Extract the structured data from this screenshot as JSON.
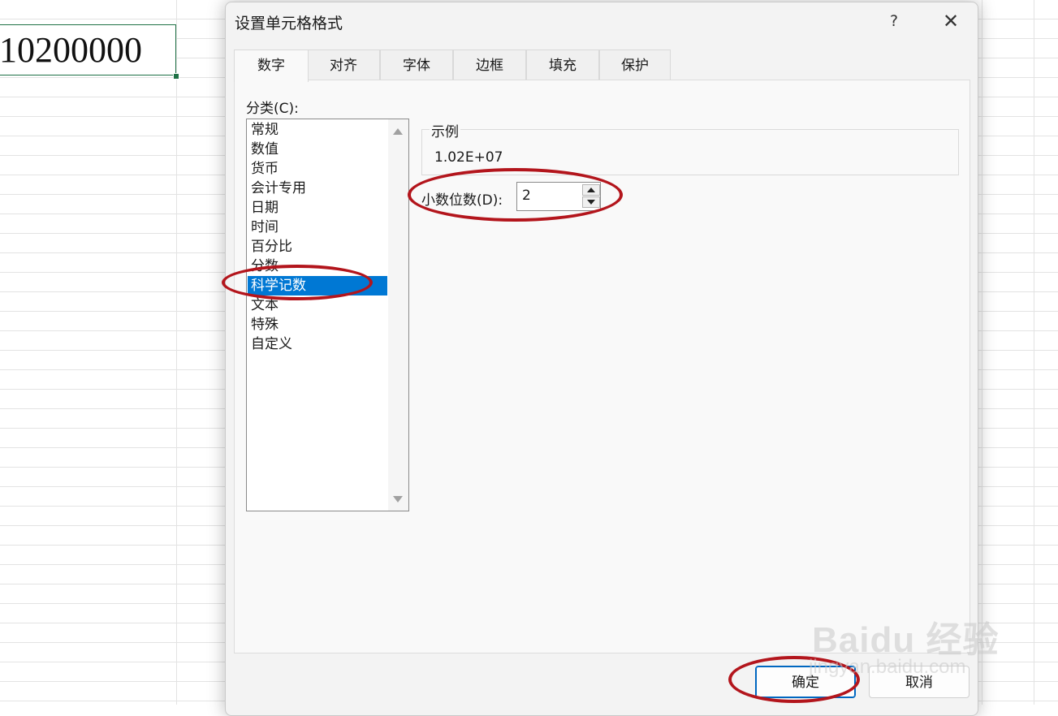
{
  "sheet": {
    "cell_value": "10200000"
  },
  "dialog": {
    "title": "设置单元格格式",
    "help_label": "?",
    "close_label": "✕",
    "tabs": [
      {
        "label": "数字",
        "active": true
      },
      {
        "label": "对齐"
      },
      {
        "label": "字体"
      },
      {
        "label": "边框"
      },
      {
        "label": "填充"
      },
      {
        "label": "保护"
      }
    ],
    "category_label": "分类(C):",
    "categories": [
      "常规",
      "数值",
      "货币",
      "会计专用",
      "日期",
      "时间",
      "百分比",
      "分数",
      "科学记数",
      "文本",
      "特殊",
      "自定义"
    ],
    "selected_category": "科学记数",
    "sample_label": "示例",
    "sample_value": "1.02E+07",
    "decimal_label": "小数位数(D):",
    "decimal_value": "2",
    "ok_label": "确定",
    "cancel_label": "取消"
  },
  "watermark": {
    "logo": "Baidu 经验",
    "url": "jingyan.baidu.com"
  },
  "colors": {
    "annotation": "#b3151c",
    "selection": "#0078d4",
    "cell_border": "#1e7145"
  }
}
